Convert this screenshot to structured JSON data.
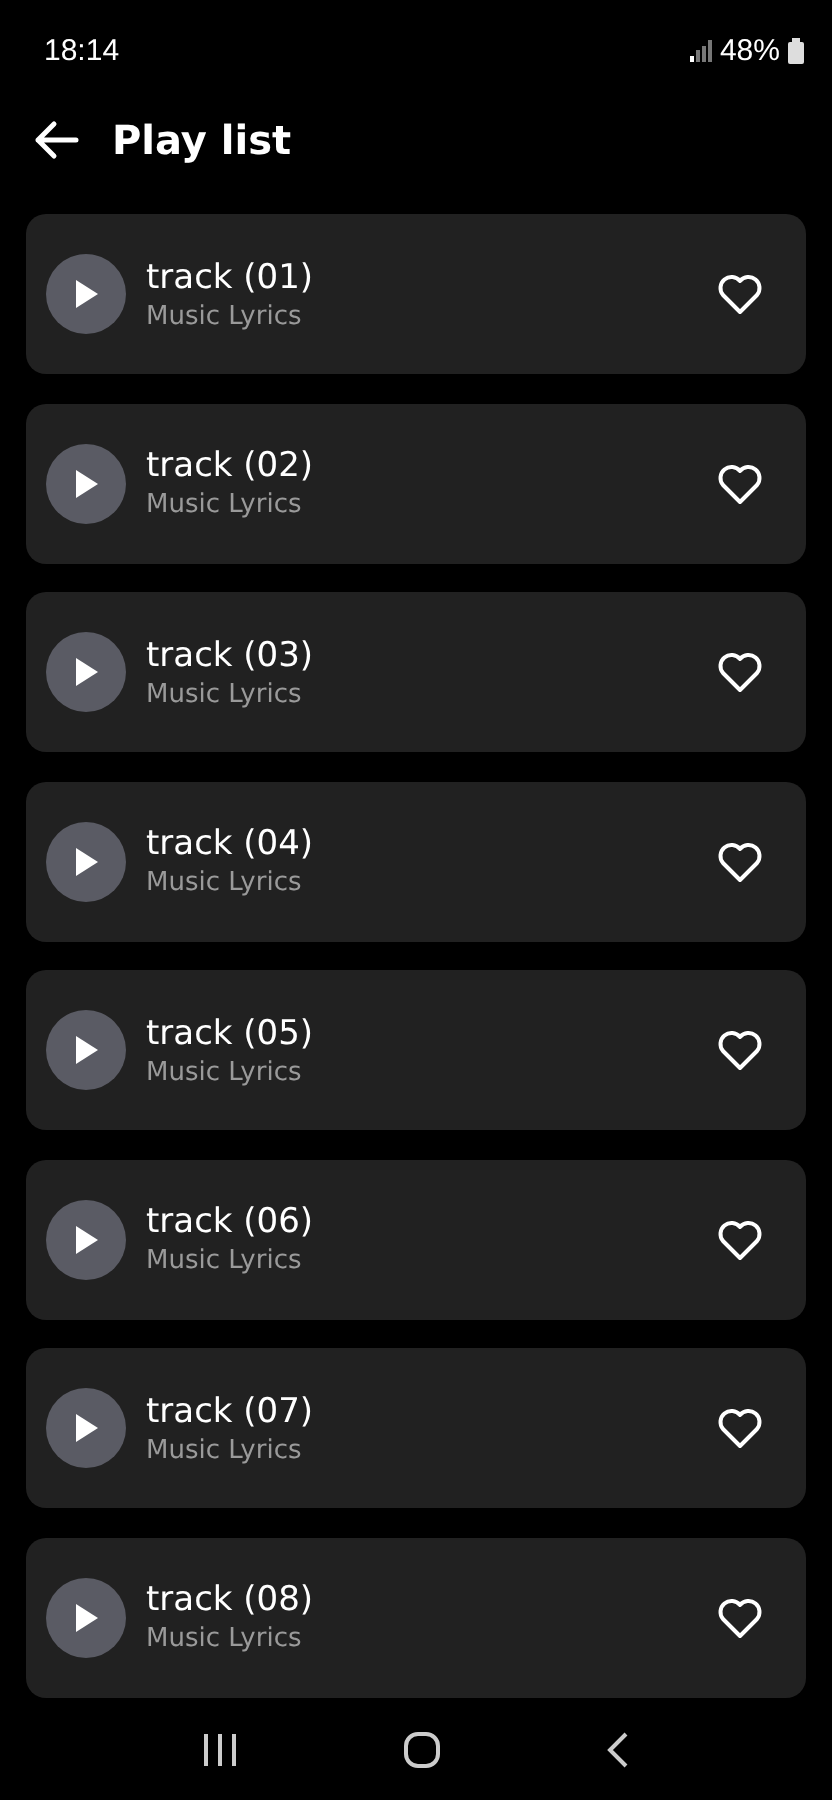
{
  "status_bar": {
    "time": "18:14",
    "battery": "48%"
  },
  "header": {
    "title": "Play list"
  },
  "tracks": [
    {
      "title": "track (01)",
      "subtitle": "Music Lyrics"
    },
    {
      "title": "track (02)",
      "subtitle": "Music Lyrics"
    },
    {
      "title": "track (03)",
      "subtitle": "Music Lyrics"
    },
    {
      "title": "track (04)",
      "subtitle": "Music Lyrics"
    },
    {
      "title": "track (05)",
      "subtitle": "Music Lyrics"
    },
    {
      "title": "track (06)",
      "subtitle": "Music Lyrics"
    },
    {
      "title": "track (07)",
      "subtitle": "Music Lyrics"
    },
    {
      "title": "track (08)",
      "subtitle": "Music Lyrics"
    }
  ]
}
